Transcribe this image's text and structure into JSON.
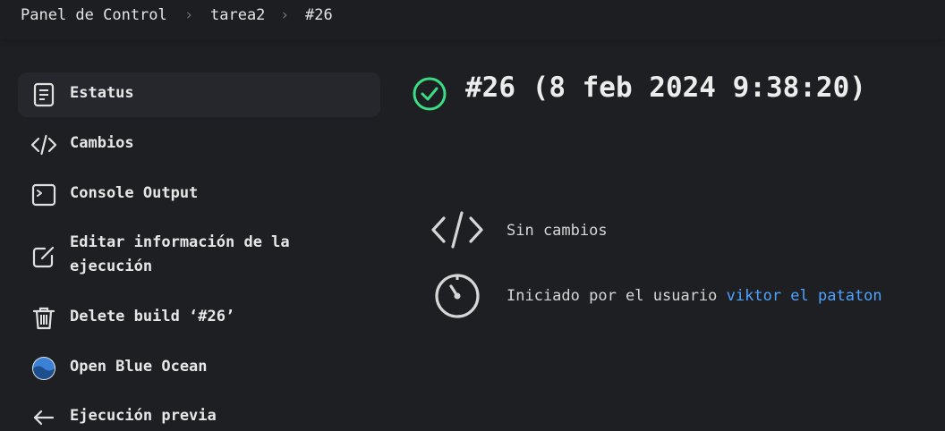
{
  "breadcrumb": {
    "items": [
      "Panel de Control",
      "tarea2",
      "#26"
    ],
    "separator": ">"
  },
  "sidebar": {
    "items": [
      {
        "label": "Estatus",
        "icon": "document-icon",
        "active": true
      },
      {
        "label": "Cambios",
        "icon": "code-icon"
      },
      {
        "label": "Console Output",
        "icon": "terminal-icon"
      },
      {
        "label_line1": "Editar información de la",
        "label_line2": "ejecución",
        "icon": "edit-icon"
      },
      {
        "label": "Delete build ‘#26’",
        "icon": "trash-icon"
      },
      {
        "label": "Open Blue Ocean",
        "icon": "blue-ocean-icon"
      },
      {
        "label": "Ejecución previa",
        "icon": "arrow-left-icon"
      }
    ]
  },
  "build": {
    "title": "#26 (8 feb 2024 9:38:20)",
    "status": "success",
    "status_color": "#3ddc84",
    "changes_text": "Sin cambios",
    "started_by_prefix": "Iniciado por el usuario",
    "started_by_user": "viktor el pataton"
  },
  "colors": {
    "background": "#1d1f22",
    "link": "#4fa3ff",
    "active_item": "#25272c"
  }
}
